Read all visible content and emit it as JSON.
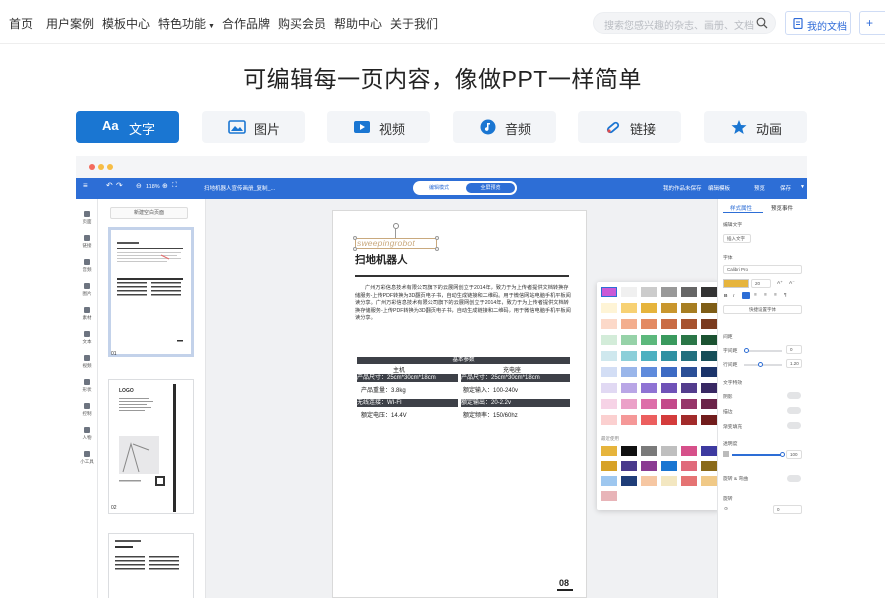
{
  "nav": {
    "items": [
      "首页",
      "用户案例",
      "模板中心",
      "特色功能",
      "合作品牌",
      "购买会员",
      "帮助中心",
      "关于我们"
    ],
    "search_placeholder": "搜索您感兴趣的杂志、画册、文档",
    "my_docs": "我的文档",
    "plus": "+"
  },
  "headline": "可编辑每一页内容，像做PPT一样简单",
  "tabs": [
    {
      "label": "文字",
      "icon": "text-aa-icon",
      "active": true
    },
    {
      "label": "图片",
      "icon": "image-icon",
      "active": false
    },
    {
      "label": "视频",
      "icon": "video-icon",
      "active": false
    },
    {
      "label": "音频",
      "icon": "music-icon",
      "active": false
    },
    {
      "label": "链接",
      "icon": "link-icon",
      "active": false
    },
    {
      "label": "动画",
      "icon": "star-icon",
      "active": false
    }
  ],
  "tab_icon_text": "Aa",
  "editor": {
    "zoom": "118%",
    "doc_name": "扫地机器人宣传画册_复制_...",
    "mode_edit": "编辑模式",
    "mode_preview": "全屏预览",
    "right_actions": [
      "我的作品未保存",
      "编辑模板",
      "预览",
      "保存"
    ],
    "add_page": "新建空白页面",
    "left_sidebar": [
      "页面",
      "链接",
      "音频",
      "图片",
      "素材",
      "文本",
      "视频",
      "形状",
      "控制",
      "人物",
      "小工具"
    ],
    "thumb_numbers": [
      "01",
      "02"
    ],
    "thumb2_logo": "LOGO",
    "page": {
      "brand": "sweepingrobot",
      "title": "扫地机器人",
      "para1": "广州万彩信息技术有限公司旗下的云展网创立于2014年，致力于为上传者提供文档转换存储服务-上传PDF转换为3D翻页电子书，自动生成链接和二维码。用于微信网站电脑手机平板阅读分享。广州万彩信息技术有限公司旗下的云展网创立于2014年，致力于为上传者提供文档转换存储服务-上传PDF转换为3D翻页电子书，自动生成链接和二维码，用于微信电脑手机平板阅读分享。",
      "params_header": "基本参数",
      "col_left": "主机",
      "col_right": "充电座",
      "rows": [
        [
          "产品尺寸：25cm*30cm*18cm",
          "产品尺寸：25cm*30cm*18cm"
        ],
        [
          "产品重量：3.8kg",
          "额定输入：100-240v"
        ],
        [
          "无线连接：WI-FI",
          "额定输出：20-2.2v"
        ],
        [
          "额定电压：14.4V",
          "额定频率：150/60hz"
        ]
      ],
      "page_number": "08"
    },
    "palette": {
      "recent_label": "最近使用",
      "grid": [
        [
          "#ffffff",
          "#f0f0f0",
          "#cccccc",
          "#999999",
          "#666666",
          "#333333"
        ],
        [
          "#fef4d6",
          "#f7d174",
          "#e6b43c",
          "#c9962d",
          "#a77e22",
          "#7e5d16"
        ],
        [
          "#fcd9c9",
          "#f3ae8e",
          "#e38a62",
          "#c96c45",
          "#a6532f",
          "#7a3b1f"
        ],
        [
          "#d3ecd9",
          "#96d2a8",
          "#5cb87c",
          "#3a9a5e",
          "#2a7647",
          "#1b5231"
        ],
        [
          "#cfe8ee",
          "#8ccfd9",
          "#4db0c0",
          "#2f91a2",
          "#22707e",
          "#164e58"
        ],
        [
          "#d3def5",
          "#9ab6ea",
          "#5f8bdc",
          "#3d6bc4",
          "#2b4f97",
          "#1b346a"
        ],
        [
          "#e1d9f3",
          "#b9a6e6",
          "#8f73d4",
          "#6f52b8",
          "#533c8d",
          "#382863"
        ],
        [
          "#f6d3e6",
          "#eba1c8",
          "#dd6ea9",
          "#c34a8a",
          "#963569",
          "#6a2349"
        ],
        [
          "#fbd0d0",
          "#f59898",
          "#ec5f5f",
          "#d43c3c",
          "#a22b2b",
          "#711c1c"
        ]
      ],
      "recent": [
        [
          "#e6b43c",
          "#111111",
          "#7a7a7a",
          "#bfbfbf",
          "#d6508a",
          "#3d3aa0"
        ],
        [
          "#d7a227",
          "#4a3a8c",
          "#8b3b92",
          "#1a76d2",
          "#e06a7b",
          "#8a6a1a"
        ],
        [
          "#9ec7ef",
          "#1f3d78",
          "#f6c7a3",
          "#f3e7c1",
          "#e57373",
          "#f0c987"
        ],
        [
          "#e8b4b8"
        ]
      ]
    },
    "right_panel": {
      "tab_style": "样式属性",
      "tab_anim": "预览事件",
      "edit_text": "编辑文字",
      "add_text": "插入文字",
      "font_label": "字体",
      "font_name": "Calibri Pro",
      "font_size": "20",
      "bold": "B",
      "italic": "I",
      "effect_btn": "快捷设置字体",
      "spacing_label": "间距",
      "letter_spacing_label": "字间距",
      "letter_spacing_value": "0",
      "line_spacing_label": "行间距",
      "line_spacing_value": "1.20",
      "text_effect_label": "文字特效",
      "shadow": "阴影",
      "stroke": "描边",
      "gradient": "渐变填充",
      "opacity_label": "透明度",
      "opacity_value": "100",
      "curve": "旋转 & 弯曲",
      "rotate_label": "旋转",
      "rotate_value": "0"
    }
  }
}
